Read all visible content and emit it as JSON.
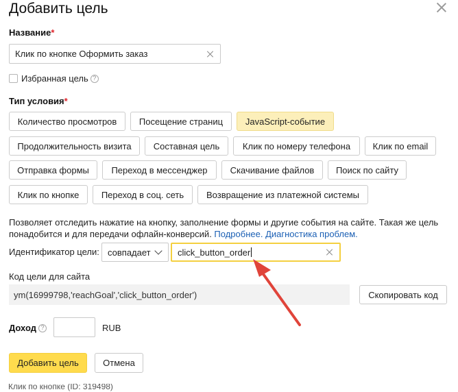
{
  "dialog": {
    "title": "Добавить цель",
    "close_icon": "close-icon"
  },
  "name_field": {
    "label": "Название",
    "required_mark": "*",
    "value": "Клик по кнопке Оформить заказ"
  },
  "favorite": {
    "label": "Избранная цель",
    "checked": false,
    "help": "?"
  },
  "condition_type": {
    "label": "Тип условия",
    "required_mark": "*",
    "options": [
      {
        "label": "Количество просмотров",
        "active": false
      },
      {
        "label": "Посещение страниц",
        "active": false
      },
      {
        "label": "JavaScript-событие",
        "active": true
      },
      {
        "label": "Продолжительность визита",
        "active": false
      },
      {
        "label": "Составная цель",
        "active": false
      },
      {
        "label": "Клик по номеру телефона",
        "active": false
      },
      {
        "label": "Клик по email",
        "active": false
      },
      {
        "label": "Отправка формы",
        "active": false
      },
      {
        "label": "Переход в мессенджер",
        "active": false
      },
      {
        "label": "Скачивание файлов",
        "active": false
      },
      {
        "label": "Поиск по сайту",
        "active": false
      },
      {
        "label": "Клик по кнопке",
        "active": false
      },
      {
        "label": "Переход в соц. сеть",
        "active": false
      },
      {
        "label": "Возвращение из платежной системы",
        "active": false
      }
    ]
  },
  "description": {
    "text": "Позволяет отследить нажатие на кнопку, заполнение формы и другие события на сайте. Такая же цель понадобится и для передачи офлайн-конверсий. ",
    "link_more": "Подробнее.",
    "link_diagnostics": "Диагностика проблем."
  },
  "identifier": {
    "label": "Идентификатор цели:",
    "match_select": "совпадает",
    "value": "click_button_order"
  },
  "site_code": {
    "label": "Код цели для сайта",
    "code": "ym(16999798,'reachGoal','click_button_order')",
    "copy_button": "Скопировать код"
  },
  "revenue": {
    "label": "Доход",
    "help": "?",
    "value": "",
    "currency": "RUB"
  },
  "actions": {
    "submit": "Добавить цель",
    "cancel": "Отмена"
  },
  "background_peek": {
    "text": "Клик по кнопке (ID: 319498)"
  },
  "colors": {
    "primary_button": "#ffdb4d",
    "active_chip": "#fcefba",
    "focus_border": "#f4cf3f",
    "annotation_arrow": "#e0443a",
    "link": "#1a5fb4",
    "required": "#e0242b"
  }
}
